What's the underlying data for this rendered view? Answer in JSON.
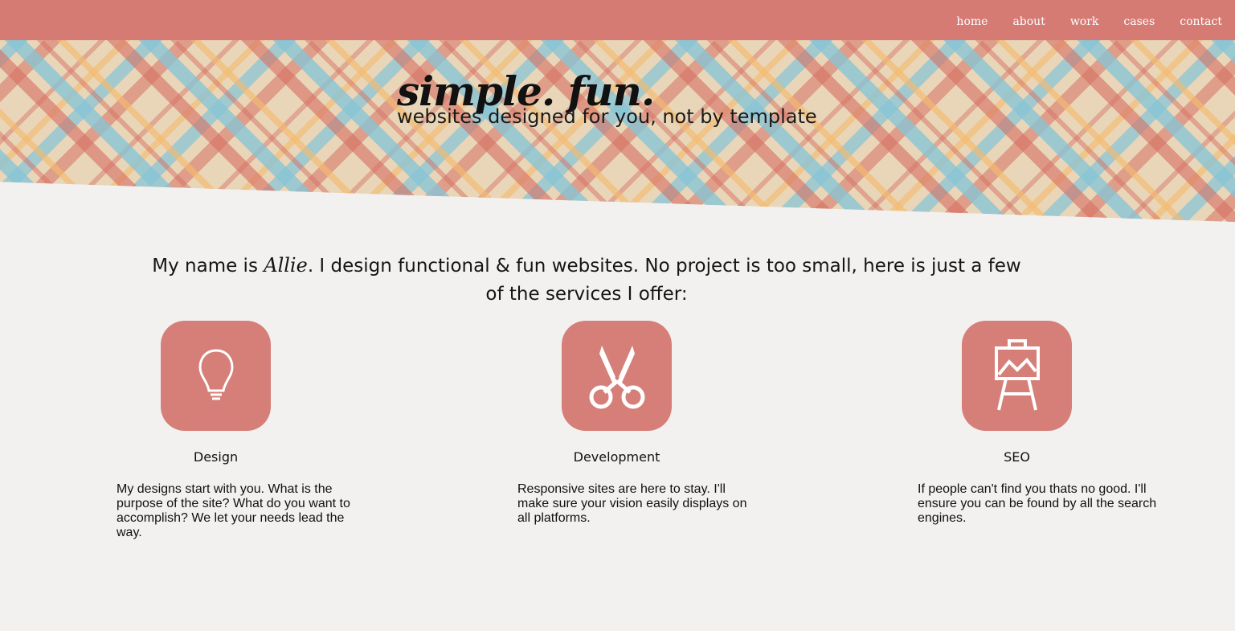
{
  "nav": {
    "items": [
      {
        "label": "home"
      },
      {
        "label": "about"
      },
      {
        "label": "work"
      },
      {
        "label": "cases"
      },
      {
        "label": "contact"
      }
    ]
  },
  "hero": {
    "title": "simple. fun.",
    "subtitle": "websites designed for you, not by template"
  },
  "intro": {
    "before": "My name is ",
    "name": "Allie",
    "after": ". I design functional & fun websites. No project is too small, here is just a few of the services I offer:"
  },
  "services": [
    {
      "icon": "lightbulb-icon",
      "title": "Design",
      "description": "My designs start with you. What is the purpose of the site? What do you want to accomplish? We let your needs lead the way."
    },
    {
      "icon": "scissors-icon",
      "title": "Development",
      "description": "Responsive sites are here to stay. I'll make sure your vision easily displays on all platforms."
    },
    {
      "icon": "easel-icon",
      "title": "SEO",
      "description": "If people can't find you thats no good. I'll ensure you can be found by all the search engines."
    }
  ],
  "colors": {
    "nav_background": "#d57b74",
    "icon_background": "#d57f78",
    "page_background": "#f3f1f0"
  }
}
